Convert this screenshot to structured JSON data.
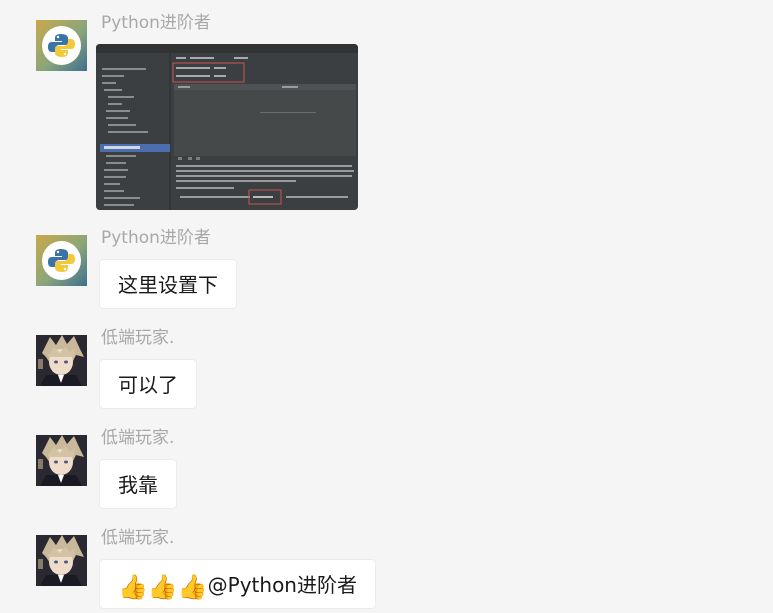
{
  "messages": [
    {
      "sender": "Python进阶者",
      "type": "image",
      "content": "IDE settings screenshot"
    },
    {
      "sender": "Python进阶者",
      "type": "text",
      "content": "这里设置下"
    },
    {
      "sender": "低端玩家.",
      "type": "text",
      "content": "可以了"
    },
    {
      "sender": "低端玩家.",
      "type": "text",
      "content": "我靠"
    },
    {
      "sender": "低端玩家.",
      "type": "text",
      "emoji": "👍👍👍",
      "content": "@Python进阶者"
    }
  ],
  "colors": {
    "background": "#f5f5f5",
    "bubble": "#ffffff",
    "name": "#a8a8a8",
    "ide_dark": "#3c3f41",
    "ide_select": "#4b6eaf",
    "highlight_box": "#c75450"
  }
}
